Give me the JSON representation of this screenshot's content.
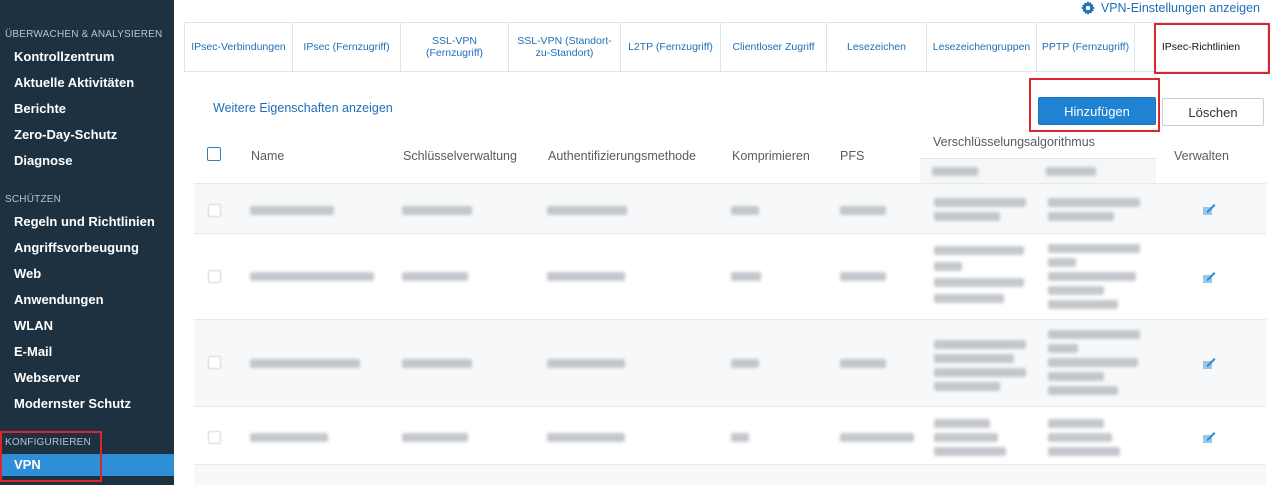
{
  "sidebar": {
    "sections": {
      "monitor": "ÜBERWACHEN & ANALYSIEREN",
      "protect": "SCHÜTZEN",
      "configure": "KONFIGURIEREN"
    },
    "monitor_items": [
      "Kontrollzentrum",
      "Aktuelle Aktivitäten",
      "Berichte",
      "Zero-Day-Schutz",
      "Diagnose"
    ],
    "protect_items": [
      "Regeln und Richtlinien",
      "Angriffsvorbeugung",
      "Web",
      "Anwendungen",
      "WLAN",
      "E-Mail",
      "Webserver",
      "Modernster Schutz"
    ],
    "configure_items": [
      "VPN"
    ],
    "active_item": "VPN"
  },
  "header": {
    "settings_link": "VPN-Einstellungen anzeigen",
    "settings_icon": "gear-icon"
  },
  "tabs": [
    "IPsec-Verbindungen",
    "IPsec (Fernzugriff)",
    "SSL-VPN (Fernzugriff)",
    "SSL-VPN (Standort-zu-Standort)",
    "L2TP (Fernzugriff)",
    "Clientloser Zugriff",
    "Lesezeichen",
    "Lesezeichengruppen",
    "PPTP (Fernzugriff)",
    "IPsec-Richtlinien"
  ],
  "active_tab": "IPsec-Richtlinien",
  "toolbar": {
    "more_properties": "Weitere Eigenschaften anzeigen",
    "add_label": "Hinzufügen",
    "delete_label": "Löschen"
  },
  "table": {
    "columns": {
      "name": "Name",
      "key_management": "Schlüsselverwaltung",
      "auth_method": "Authentifizierungsmethode",
      "compress": "Komprimieren",
      "pfs": "PFS",
      "encryption": "Verschlüsselungsalgorithmus",
      "manage": "Verwalten"
    },
    "row_count_visible": 4
  },
  "colors": {
    "sidebar_bg": "#1e3140",
    "accent": "#2e8ed6",
    "link": "#1e6fb8",
    "highlight_box": "#d9262c"
  }
}
